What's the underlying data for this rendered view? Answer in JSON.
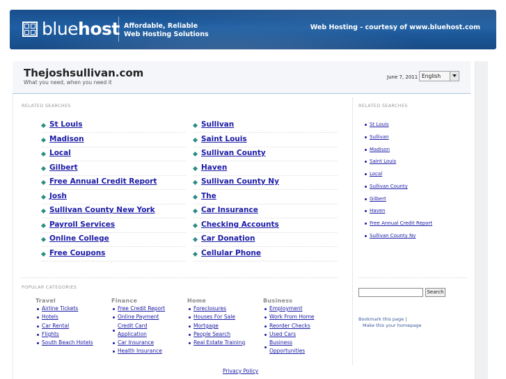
{
  "banner": {
    "logo_light": "blue",
    "logo_bold": "host",
    "tagline_1": "Affordable, Reliable",
    "tagline_2": "Web Hosting Solutions",
    "courtesy": "Web Hosting - courtesy of www.bluehost.com"
  },
  "header": {
    "title": "Thejoshsullivan.com",
    "subtitle": "What you need, when you need it",
    "date": "June 7, 2011",
    "language": "English"
  },
  "related": {
    "heading": "RELATED SEARCHES",
    "left": [
      "St Louis",
      "Madison",
      "Local",
      "Gilbert",
      "Free Annual Credit Report",
      "Josh",
      "Sullivan County New York",
      "Payroll Services",
      "Online College",
      "Free Coupons"
    ],
    "right": [
      "Sullivan",
      "Saint Louis",
      "Sullivan County",
      "Haven",
      "Sullivan County Ny",
      "The",
      "Car Insurance",
      "Checking Accounts",
      "Car Donation",
      "Cellular Phone"
    ]
  },
  "sidebar": {
    "heading": "RELATED SEARCHES",
    "items": [
      "St Louis",
      "Sullivan",
      "Madison",
      "Saint Louis",
      "Local",
      "Sullivan County",
      "Gilbert",
      "Haven",
      "Free Annual Credit Report",
      "Sullivan County Ny"
    ],
    "search_button": "Search",
    "search_value": "",
    "bookmark": "Bookmark this page",
    "homepage": "Make this your homepage"
  },
  "popular": {
    "heading": "POPULAR CATEGORIES",
    "travel": {
      "title": "Travel",
      "items": [
        "Airline Tickets",
        "Hotels",
        "Car Rental",
        "Flights",
        "South Beach Hotels"
      ]
    },
    "finance": {
      "title": "Finance",
      "items": [
        "Free Credit Report",
        "Online Payment",
        "Credit Card",
        "Application",
        "Car Insurance",
        "Health Insurance"
      ]
    },
    "home": {
      "title": "Home",
      "items": [
        "Foreclosures",
        "Houses For Sale",
        "Mortgage",
        "People Search",
        "Real Estate Training"
      ]
    },
    "business": {
      "title": "Business",
      "items": [
        "Employment",
        "Work From Home",
        "Reorder Checks",
        "Used Cars",
        "Business",
        "Opportunities"
      ]
    }
  },
  "footer": {
    "privacy": "Privacy Policy"
  }
}
